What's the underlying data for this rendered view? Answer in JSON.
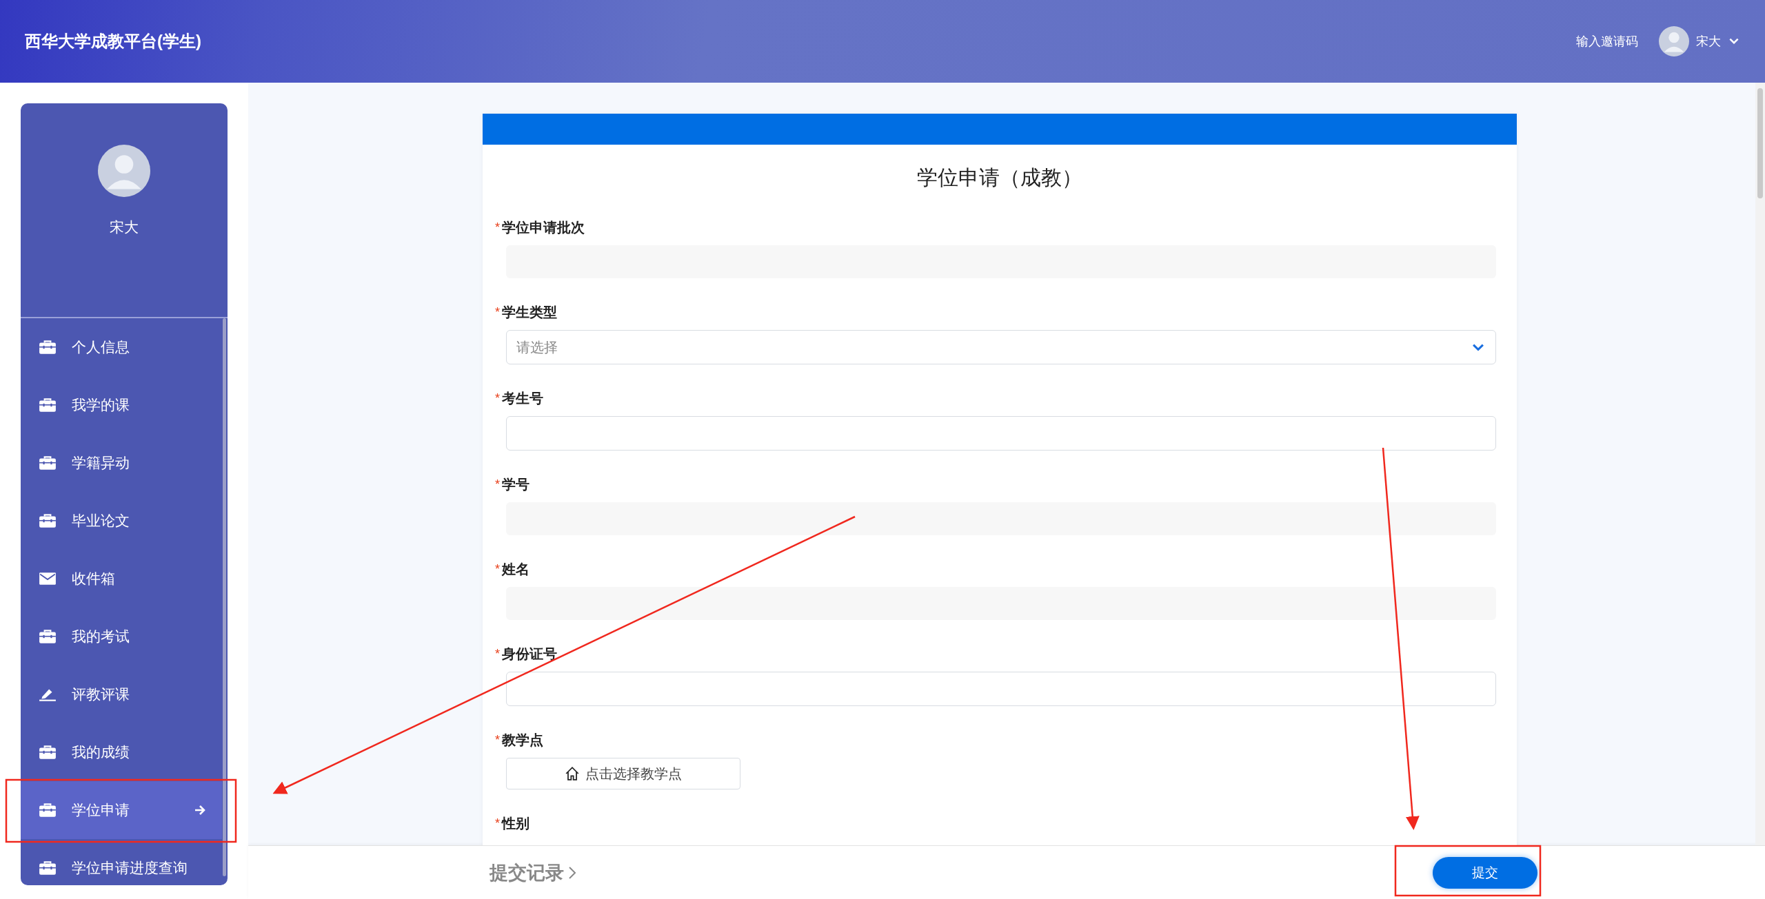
{
  "header": {
    "title": "西华大学成教平台(学生)",
    "invite_link": "输入邀请码",
    "user_name": "宋大"
  },
  "sidebar": {
    "profile_name": "宋大",
    "items": [
      {
        "label": "个人信息",
        "kind": "briefcase",
        "selected": false
      },
      {
        "label": "我学的课",
        "kind": "briefcase",
        "selected": false
      },
      {
        "label": "学籍异动",
        "kind": "briefcase",
        "selected": false
      },
      {
        "label": "毕业论文",
        "kind": "briefcase",
        "selected": false
      },
      {
        "label": "收件箱",
        "kind": "mail",
        "selected": false
      },
      {
        "label": "我的考试",
        "kind": "briefcase",
        "selected": false
      },
      {
        "label": "评教评课",
        "kind": "pen",
        "selected": false
      },
      {
        "label": "我的成绩",
        "kind": "briefcase",
        "selected": false
      },
      {
        "label": "学位申请",
        "kind": "briefcase",
        "selected": true
      },
      {
        "label": "学位申请进度查询",
        "kind": "briefcase",
        "selected": false
      }
    ]
  },
  "form": {
    "title": "学位申请（成教）",
    "fields": [
      {
        "label": "学位申请批次",
        "required_mark": "*",
        "kind": "readonly"
      },
      {
        "label": "学生类型",
        "required_mark": "*",
        "kind": "select",
        "placeholder": "请选择"
      },
      {
        "label": "考生号",
        "required_mark": "*",
        "kind": "input"
      },
      {
        "label": "学号",
        "required_mark": "*",
        "kind": "readonly"
      },
      {
        "label": "姓名",
        "required_mark": "*",
        "kind": "readonly"
      },
      {
        "label": "身份证号",
        "required_mark": "*",
        "kind": "input"
      },
      {
        "label": "教学点",
        "required_mark": "*",
        "kind": "picker",
        "button_label": "点击选择教学点"
      },
      {
        "label": "性别",
        "required_mark": "*",
        "kind": "label_only"
      }
    ]
  },
  "footer": {
    "history_link": "提交记录",
    "submit": "提交"
  }
}
